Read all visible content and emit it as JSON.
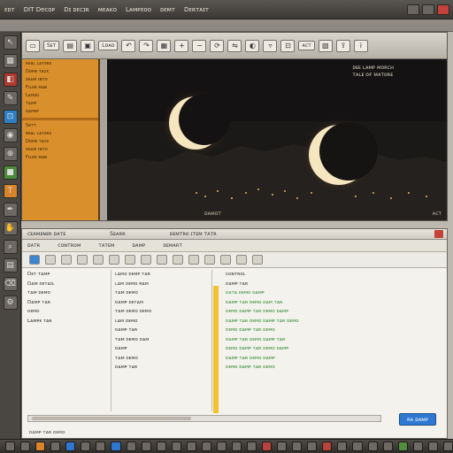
{
  "titlebar": {
    "menu": [
      "ᴇᴅᴛ",
      "DIT Deᴄoᴘ",
      "Dɪ ᴅᴇᴄɪʀ",
      "ᴍᴇᴀᴋᴏ",
      "Lᴀᴍᴘᴇᴏᴏ",
      "ᴅᴇᴍᴛ",
      "Dᴇʀᴛᴀɪᴛ"
    ]
  },
  "rail": {
    "icons": [
      "cursor-icon",
      "image-icon",
      "layers-icon",
      "brush-icon",
      "crop-icon",
      "eye-icon",
      "target-icon",
      "square-icon",
      "text-icon",
      "pen-icon"
    ]
  },
  "upper": {
    "toolbar_labels": [
      "Sᴇᴛ",
      "Lᴏᴀᴅ",
      "ᴀᴄᴛ"
    ],
    "side_panel": {
      "rows": [
        "ʀᴇᴀʟ ʟᴀʏᴇʀs",
        "Dᴏᴍᴇ ᴛᴀᴄᴋ",
        "ᴅᴇᴀᴍ ɪɴᴛᴏ",
        "Fɪʟᴇʀ ᴍᴀɴ",
        "Lᴀᴍᴇᴅ",
        "ᴛᴀᴍᴘ",
        "ᴅᴀᴍᴇᴘ"
      ],
      "section_label": "Seᴛᴛ"
    },
    "viewer": {
      "caption_line1": "ᴅᴇᴇ ʟᴀᴍᴘ ᴍᴏʀᴄʜ",
      "caption_line2": "ᴛᴀʟᴇ ᴏғ ᴍᴀᴛᴏʀᴇ",
      "footer": "ᴅᴀᴍᴏᴛ",
      "corner": "ᴀᴄᴛ"
    }
  },
  "lower": {
    "title_left": "ᴄᴇᴀᴍᴇɴᴇʀ ᴅᴀᴛᴇ",
    "title_mid": "Sᴇᴀʀʀ",
    "title_right": "ᴅᴇᴍᴛʀᴏ ɪᴛᴇᴍ ᴛᴀᴛʀ",
    "toolbar": [
      "ᴅᴀᴛʀ",
      "ᴄᴏɴᴛʀᴏᴍ",
      "ᴛᴀᴛᴇᴍ",
      "ᴅᴀᴍᴘ",
      "ᴅᴇᴍᴀʀᴛ"
    ],
    "col1": [
      "Dᴇᴛ ᴛᴀᴍᴘ",
      "Dᴀᴍ ᴅᴇᴛᴀɪʟ",
      "ᴛᴀᴍ ᴅᴇᴍᴏ",
      "Dᴀᴍᴘ ᴛᴀʀ",
      "ᴅᴇᴍᴏ",
      "Lᴀᴍᴘᴇ ᴛᴀʀ"
    ],
    "col2": [
      "ʟᴀᴍᴏ ᴅᴇᴍᴘ ᴛᴀʀ",
      "ʟᴀᴍ ᴅᴇᴍᴏ ʀᴀᴍ",
      "ᴛᴀᴍ ᴅᴇᴍᴏ",
      "ᴅᴀᴍᴘ ᴅᴇᴛᴀᴍ",
      "ᴛᴀᴍ ᴅᴇᴍᴏ ᴅᴇᴍᴏ",
      "ʟᴀᴍ ᴅᴇᴍᴏ",
      "ᴅᴀᴍᴘ ᴛᴀʀ",
      "ᴛᴀᴍ ᴅᴇᴍᴏ ᴅᴀᴍ",
      "ᴅᴀᴍᴘ",
      "ᴛᴀᴍ ᴅᴇᴍᴏ",
      "ᴅᴀᴍᴘ ᴛᴀʀ"
    ],
    "col4_head": [
      "ᴄᴏɴᴛʀᴏʟ",
      "ᴅᴀᴍᴘ ᴛᴀʀ"
    ],
    "col4": [
      "ᴅᴀᴛᴀ ᴅᴇᴍᴏ ᴅᴀᴍᴘ",
      "ᴅᴀᴍᴘ ᴛᴀʀ ᴅᴇᴍᴏ ᴅᴀᴍ ᴛᴀʀ",
      "ᴅᴇᴍᴏ ᴅᴀᴍᴘ ᴛᴀʀ ᴅᴇᴍᴏ ᴅᴀᴍᴘ",
      "ᴅᴀᴍᴘ ᴛᴀʀ ᴅᴇᴍᴏ ᴅᴀᴍᴘ ᴛᴀʀ ᴅᴇᴍᴏ",
      "ᴅᴇᴍᴏ ᴅᴀᴍᴘ ᴛᴀʀ ᴅᴇᴍᴏ",
      "ᴅᴀᴍᴘ ᴛᴀʀ ᴅᴇᴍᴏ ᴅᴀᴍᴘ ᴛᴀʀ",
      "ᴅᴇᴍᴏ ᴅᴀᴍᴘ ᴛᴀʀ ᴅᴇᴍᴏ ᴅᴀᴍᴘ",
      "ᴅᴀᴍᴘ ᴛᴀʀ ᴅᴇᴍᴏ ᴅᴀᴍᴘ",
      "ᴅᴇᴍᴏ ᴅᴀᴍᴘ ᴛᴀʀ ᴅᴇᴍᴏ"
    ],
    "ok_label": "ʀᴀ ᴅᴀᴍᴘ",
    "status": "ᴅᴀᴍᴘ ᴛᴀʀ ᴅᴇᴍᴏ"
  },
  "colors": {
    "accent": "#2e78d1",
    "panel": "#d98f2c",
    "code_green": "#2f8a34"
  }
}
